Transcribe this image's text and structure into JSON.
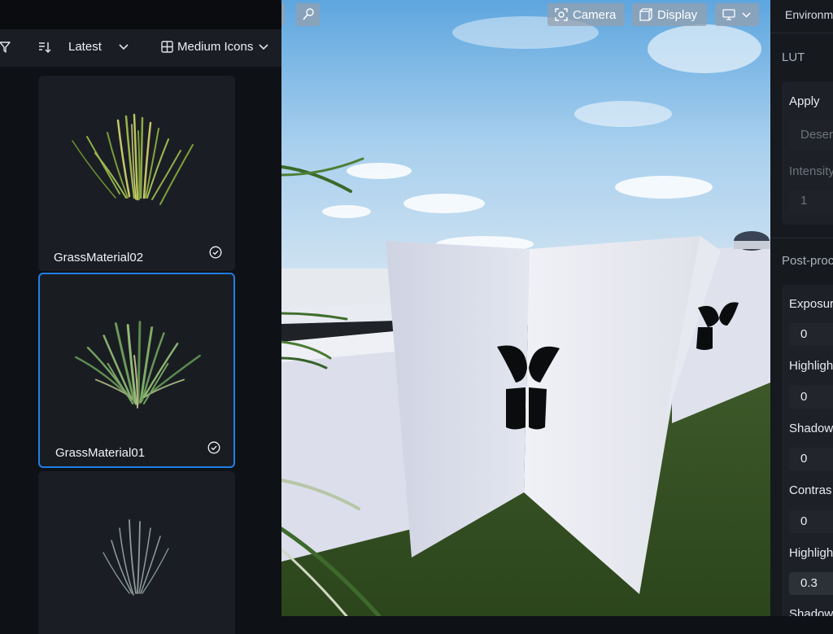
{
  "asset_browser": {
    "sort_label": "Latest",
    "view_label": "Medium Icons",
    "items": [
      {
        "name": "GrassMaterial02",
        "status": "checked",
        "selected": false
      },
      {
        "name": "GrassMaterial01",
        "status": "checked",
        "selected": true
      },
      {
        "name": "",
        "status": "",
        "selected": false
      }
    ]
  },
  "viewport": {
    "camera_label": "Camera",
    "display_label": "Display"
  },
  "properties": {
    "header": "Environm",
    "lut": {
      "section": "LUT",
      "apply_label": "Apply",
      "preset_placeholder": "Deser",
      "intensity_label": "Intensity",
      "intensity_value": "1"
    },
    "post_processing": {
      "section": "Post-proc",
      "fields": [
        {
          "label": "Exposur",
          "value": "0"
        },
        {
          "label": "Highligh",
          "value": "0"
        },
        {
          "label": "Shadow",
          "value": "0"
        },
        {
          "label": "Contras",
          "value": "0"
        },
        {
          "label": "Highligh",
          "value": "0.3"
        },
        {
          "label": "Shadow",
          "value": ""
        }
      ]
    }
  },
  "colors": {
    "accent": "#1f7fe6",
    "panel_bg": "#16191e",
    "card_bg": "#1a1e24"
  }
}
